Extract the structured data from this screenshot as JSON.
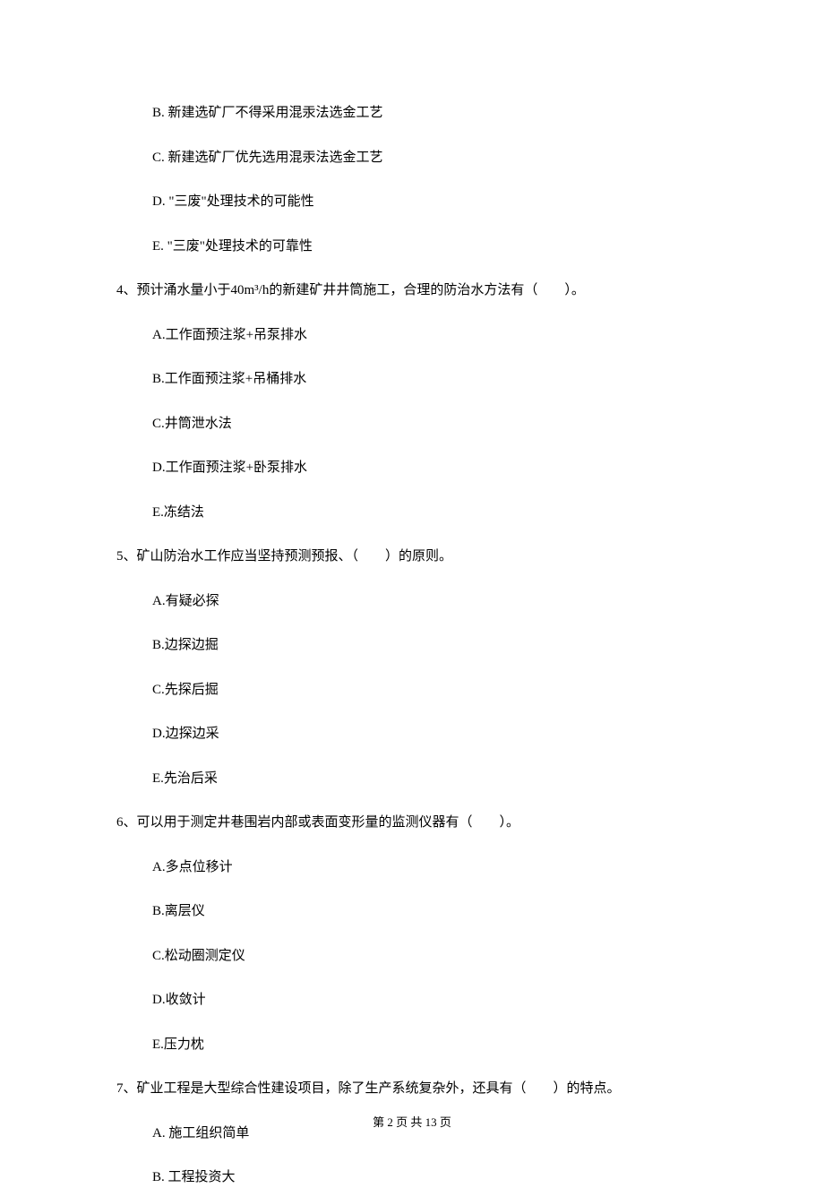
{
  "partial_options_top": {
    "b": "B.  新建选矿厂不得采用混汞法选金工艺",
    "c": "C.  新建选矿厂优先选用混汞法选金工艺",
    "d": "D.  \"三废\"处理技术的可能性",
    "e": "E.  \"三废\"处理技术的可靠性"
  },
  "q4": {
    "stem": "4、预计涌水量小于40m³/h的新建矿井井筒施工，合理的防治水方法有（　　）。",
    "a": "A.工作面预注浆+吊泵排水",
    "b": "B.工作面预注浆+吊桶排水",
    "c": "C.井筒泄水法",
    "d": "D.工作面预注浆+卧泵排水",
    "e": "E.冻结法"
  },
  "q5": {
    "stem": "5、矿山防治水工作应当坚持预测预报、（　　）的原则。",
    "a": "A.有疑必探",
    "b": "B.边探边掘",
    "c": "C.先探后掘",
    "d": "D.边探边采",
    "e": "E.先治后采"
  },
  "q6": {
    "stem": "6、可以用于测定井巷围岩内部或表面变形量的监测仪器有（　　）。",
    "a": "A.多点位移计",
    "b": "B.离层仪",
    "c": "C.松动圈测定仪",
    "d": "D.收敛计",
    "e": "E.压力枕"
  },
  "q7": {
    "stem": "7、矿业工程是大型综合性建设项目，除了生产系统复杂外，还具有（　　）的特点。",
    "a": "A.  施工组织简单",
    "b": "B.  工程投资大"
  },
  "footer": "第 2 页 共 13 页"
}
